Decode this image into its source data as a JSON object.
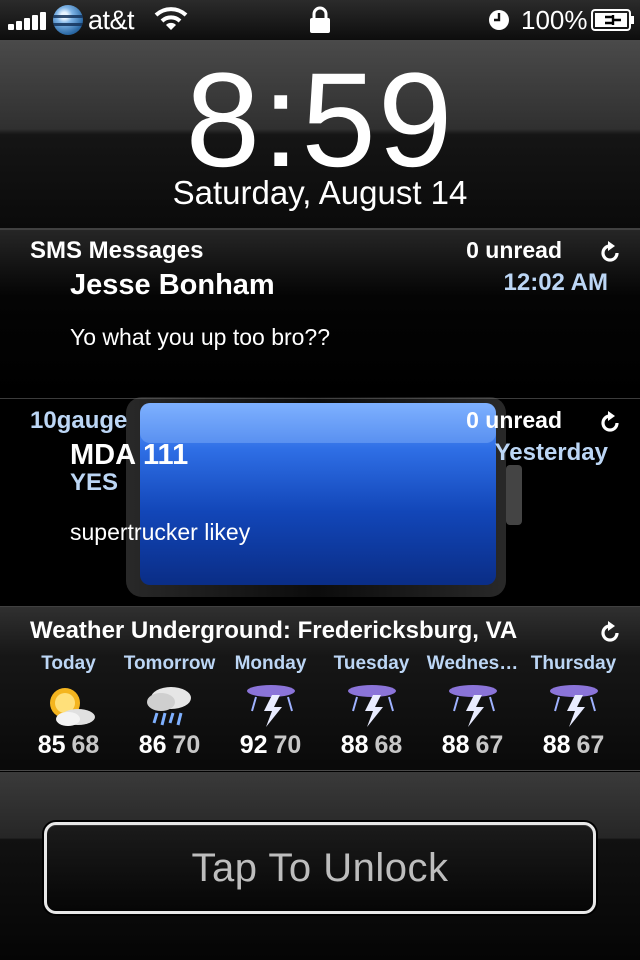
{
  "status_bar": {
    "carrier": "at&t",
    "battery_percent": "100%",
    "signal_bars": 5,
    "icons": [
      "signal-icon",
      "att-globe-icon",
      "wifi-icon",
      "lock-icon",
      "clock-icon",
      "battery-charging-icon"
    ]
  },
  "clock": {
    "time": "8:59",
    "date": "Saturday, August 14"
  },
  "sms_widget": {
    "title": "SMS Messages",
    "unread": "0 unread",
    "sender": "Jesse Bonham",
    "time": "12:02 AM",
    "body": "Yo what you up too bro??"
  },
  "mail_widget": {
    "title": "10gauge",
    "unread": "0 unread",
    "sender": "MDA 111",
    "subject": "YES",
    "time": "Yesterday",
    "body": "supertrucker likey"
  },
  "weather_widget": {
    "title": "Weather Underground: Fredericksburg, VA",
    "forecast": [
      {
        "day": "Today",
        "high": "85",
        "low": "68",
        "icon": "sun-cloud-icon"
      },
      {
        "day": "Tomorrow",
        "high": "86",
        "low": "70",
        "icon": "rain-cloud-icon"
      },
      {
        "day": "Monday",
        "high": "92",
        "low": "70",
        "icon": "thunderstorm-icon"
      },
      {
        "day": "Tuesday",
        "high": "88",
        "low": "68",
        "icon": "thunderstorm-icon"
      },
      {
        "day": "Wednes…",
        "high": "88",
        "low": "67",
        "icon": "thunderstorm-icon"
      },
      {
        "day": "Thursday",
        "high": "88",
        "low": "67",
        "icon": "thunderstorm-icon"
      }
    ]
  },
  "unlock": {
    "label": "Tap To Unlock"
  },
  "colors": {
    "accent_blue": "#bcd6f5",
    "battery_blue": "#1f5fd6"
  }
}
